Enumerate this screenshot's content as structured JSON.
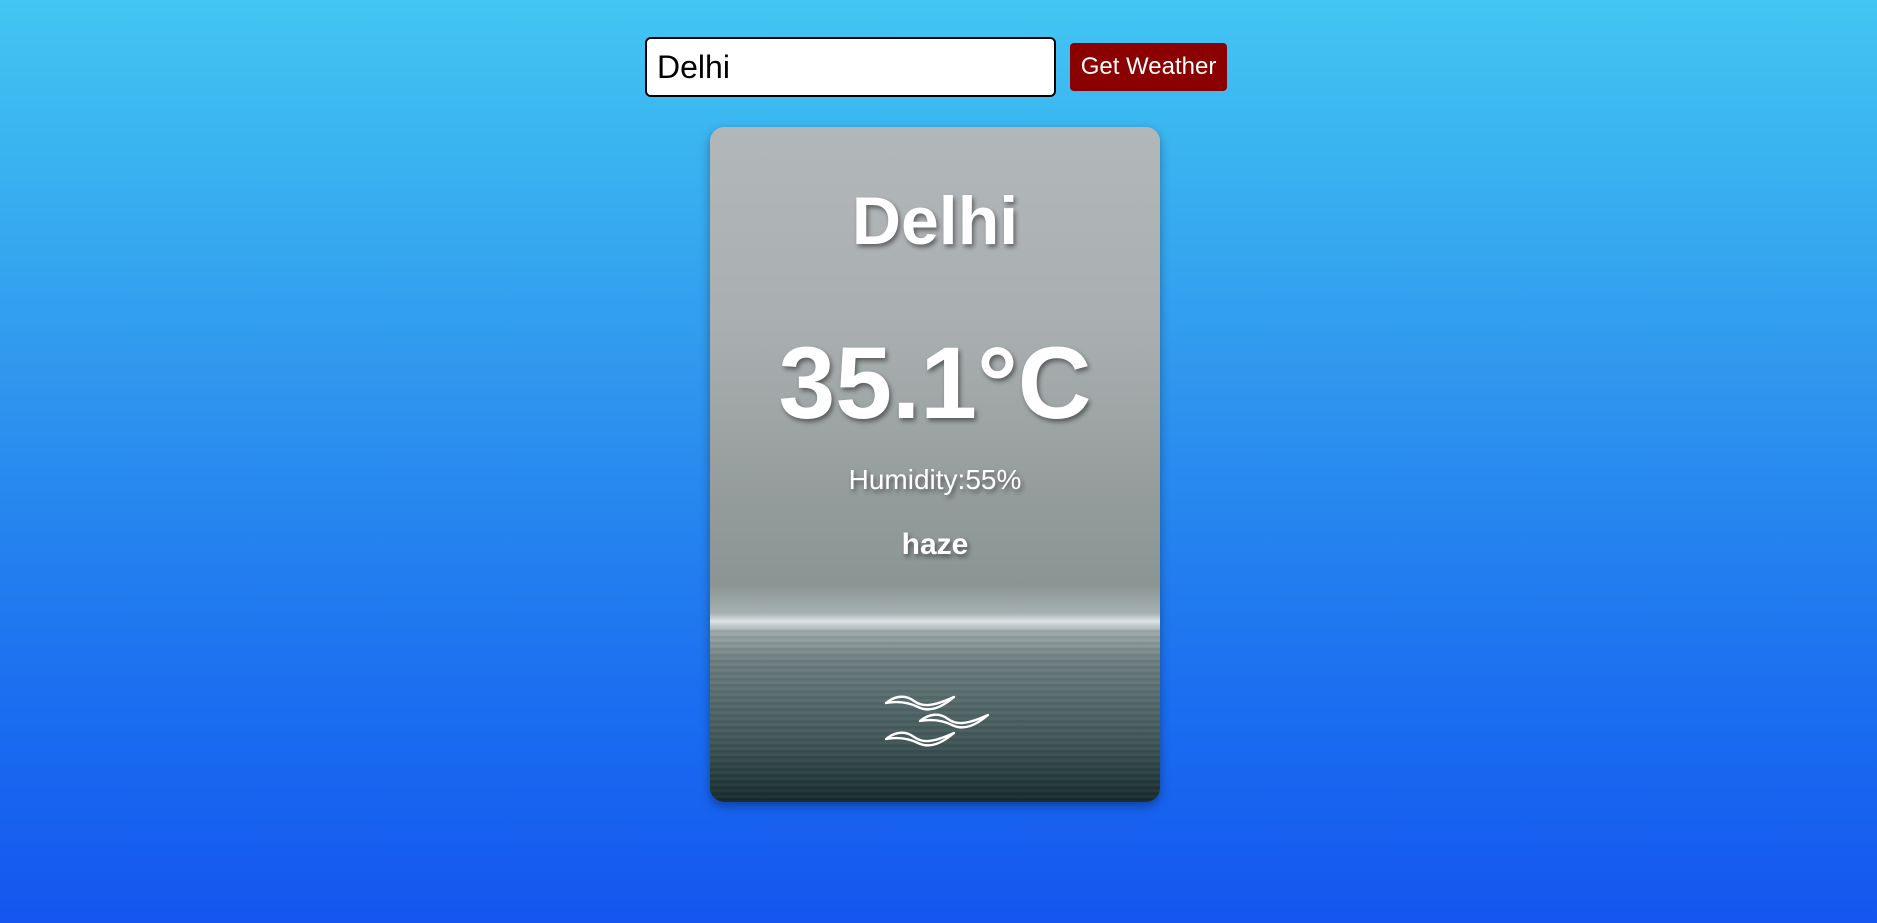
{
  "search": {
    "value": "Delhi",
    "button_label": "Get Weather"
  },
  "weather": {
    "city": "Delhi",
    "temperature": "35.1°C",
    "humidity": "Humidity:55%",
    "description": "haze",
    "icon": "haze-wind-icon"
  },
  "colors": {
    "button_bg": "#8b0000",
    "background_top": "#42c6f2",
    "background_bottom": "#1456ef"
  }
}
